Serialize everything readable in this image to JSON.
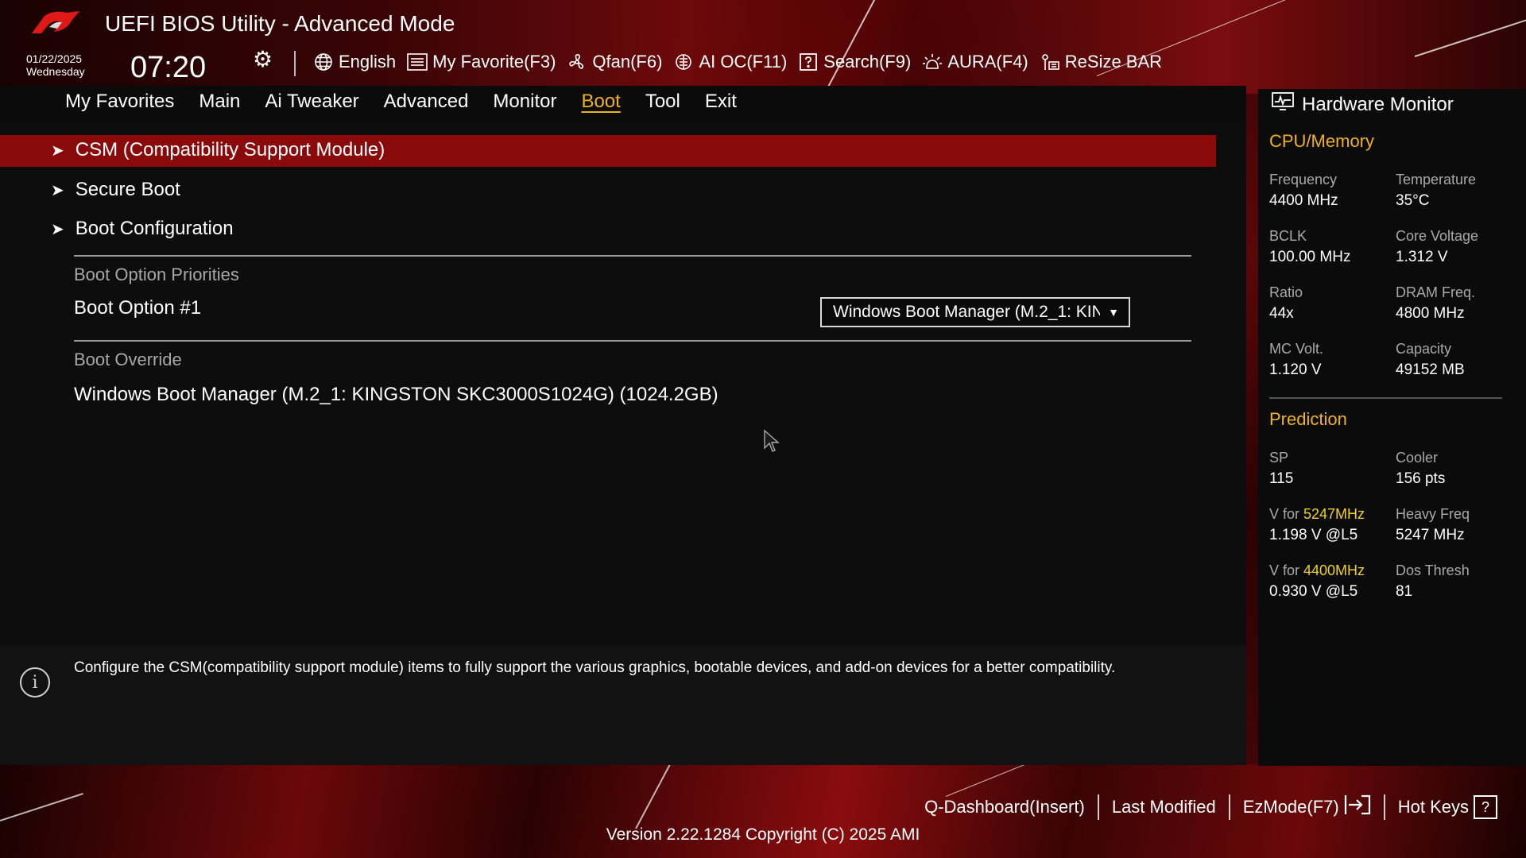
{
  "header": {
    "title": "UEFI BIOS Utility - Advanced Mode",
    "date": "01/22/2025",
    "weekday": "Wednesday",
    "time": "07:20",
    "toolbar": [
      {
        "label": "English",
        "icon": "globe-icon"
      },
      {
        "label": "My Favorite(F3)",
        "icon": "favorite-list-icon"
      },
      {
        "label": "Qfan(F6)",
        "icon": "fan-icon"
      },
      {
        "label": "AI OC(F11)",
        "icon": "ai-chip-icon"
      },
      {
        "label": "Search(F9)",
        "icon": "search-question-icon"
      },
      {
        "label": "AURA(F4)",
        "icon": "aura-light-icon"
      },
      {
        "label": "ReSize BAR",
        "icon": "resize-bar-icon"
      }
    ]
  },
  "menu": {
    "items": [
      "My Favorites",
      "Main",
      "Ai Tweaker",
      "Advanced",
      "Monitor",
      "Boot",
      "Tool",
      "Exit"
    ],
    "active": "Boot"
  },
  "boot": {
    "submenus": [
      "CSM (Compatibility Support Module)",
      "Secure Boot",
      "Boot Configuration"
    ],
    "priorities_label": "Boot Option Priorities",
    "boot_option_label": "Boot Option #1",
    "boot_option_value": "Windows Boot Manager (M.2_1: KINGSTON SKC3000S1024G) (1024.2GB)",
    "override_label": "Boot Override",
    "override_item": "Windows Boot Manager (M.2_1: KINGSTON SKC3000S1024G) (1024.2GB)"
  },
  "help": {
    "text": "Configure the CSM(compatibility support module) items to fully support the various graphics, bootable devices, and add-on devices for a better compatibility."
  },
  "hardware_monitor": {
    "title": "Hardware Monitor",
    "cpu_memory": {
      "heading": "CPU/Memory",
      "frequency_label": "Frequency",
      "frequency": "4400 MHz",
      "temperature_label": "Temperature",
      "temperature": "35°C",
      "bclk_label": "BCLK",
      "bclk": "100.00 MHz",
      "core_voltage_label": "Core Voltage",
      "core_voltage": "1.312 V",
      "ratio_label": "Ratio",
      "ratio": "44x",
      "dram_freq_label": "DRAM Freq.",
      "dram_freq": "4800 MHz",
      "mc_volt_label": "MC Volt.",
      "mc_volt": "1.120 V",
      "capacity_label": "Capacity",
      "capacity": "49152 MB"
    },
    "prediction": {
      "heading": "Prediction",
      "sp_label": "SP",
      "sp": "115",
      "cooler_label": "Cooler",
      "cooler": "156 pts",
      "v_for_prefix": "V for ",
      "v_for_1_freq": "5247MHz",
      "v_for_1_value": "1.198 V @L5",
      "heavy_freq_label": "Heavy Freq",
      "heavy_freq": "5247 MHz",
      "v_for_2_freq": "4400MHz",
      "v_for_2_value": "0.930 V @L5",
      "dos_thresh_label": "Dos Thresh",
      "dos_thresh": "81"
    }
  },
  "footer": {
    "q_dashboard": "Q-Dashboard(Insert)",
    "last_modified": "Last Modified",
    "ezmode": "EzMode(F7)",
    "hot_keys": "Hot Keys",
    "version": "Version 2.22.1284 Copyright (C) 2025 AMI"
  },
  "colors": {
    "accent": "#f0b21b",
    "selection": "#8a0a0c",
    "highlight_freq": "#f0d11b"
  }
}
